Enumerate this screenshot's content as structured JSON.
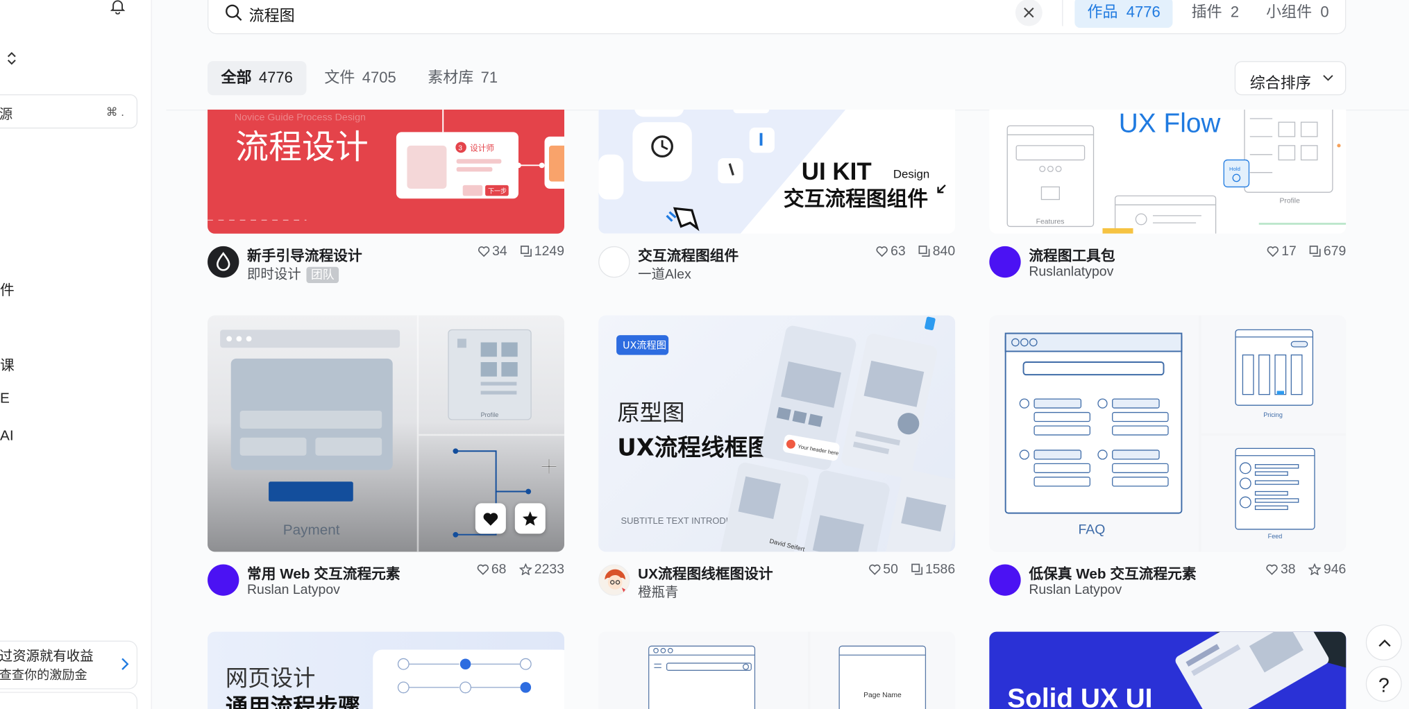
{
  "sidebar": {
    "search_placeholder": "源",
    "shortcut": "⌘ .",
    "frag_1": "件",
    "frag_2": "课",
    "frag_3": "E",
    "frag_4": "AI",
    "promo_line1": "过资源就有收益",
    "promo_line2": "查查你的激励金"
  },
  "search": {
    "query": "流程图",
    "scopes": [
      {
        "label": "作品",
        "count": "4776"
      },
      {
        "label": "插件",
        "count": "2"
      },
      {
        "label": "小组件",
        "count": "0"
      }
    ]
  },
  "tabs": [
    {
      "label": "全部",
      "count": "4776"
    },
    {
      "label": "文件",
      "count": "4705"
    },
    {
      "label": "素材库",
      "count": "71"
    }
  ],
  "sort_label": "综合排序",
  "cards": [
    {
      "title": "新手引导流程设计",
      "author": "即时设计",
      "tag": "团队",
      "likes": "34",
      "copies": "1249",
      "thumb": {
        "heading": "流程设计",
        "subtitle": "Novice Guide Process Design",
        "badge": "设计师",
        "badge_no": "3",
        "button": "下一步"
      }
    },
    {
      "title": "交互流程图组件",
      "author": "一道Alex",
      "likes": "63",
      "copies": "840",
      "thumb": {
        "heading": "UI KIT",
        "design": "Design",
        "subtitle": "交互流程图组件"
      }
    },
    {
      "title": "流程图工具包",
      "author": "Ruslanlatypov",
      "likes": "17",
      "copies": "679",
      "thumb": {
        "heading": "UX Flow",
        "label_a": "Features",
        "label_b": "Profile",
        "label_c": "Hold"
      }
    },
    {
      "title": "常用 Web 交互流程元素",
      "author": "Ruslan Latypov",
      "likes": "68",
      "stars": "2233",
      "thumb": {
        "label_a": "Payment",
        "label_b": "Profile"
      }
    },
    {
      "title": "UX流程图线框图设计",
      "author": "橙瓶青",
      "likes": "50",
      "copies": "1586",
      "thumb": {
        "badge": "UX流程图",
        "line1": "原型图",
        "line2": "UX流程线框图",
        "subtitle": "SUBTITLE TEXT INTRODUCTION",
        "toast": "Your header here",
        "name": "David Seifert"
      }
    },
    {
      "title": "低保真 Web 交互流程元素",
      "author": "Ruslan Latypov",
      "likes": "38",
      "stars": "946",
      "thumb": {
        "label_a": "FAQ",
        "label_b": "Pricing",
        "label_c": "Feed"
      }
    },
    {
      "thumb": {
        "line1": "网页设计",
        "line2": "通用流程步骤"
      }
    },
    {
      "thumb": {
        "label_a": "Page Name"
      }
    },
    {
      "thumb": {
        "heading": "Solid UX UI"
      }
    }
  ],
  "colors": {
    "accent": "#1f7ae0",
    "avatar_purple": "#4b12f3",
    "card_red": "#e4434a"
  }
}
